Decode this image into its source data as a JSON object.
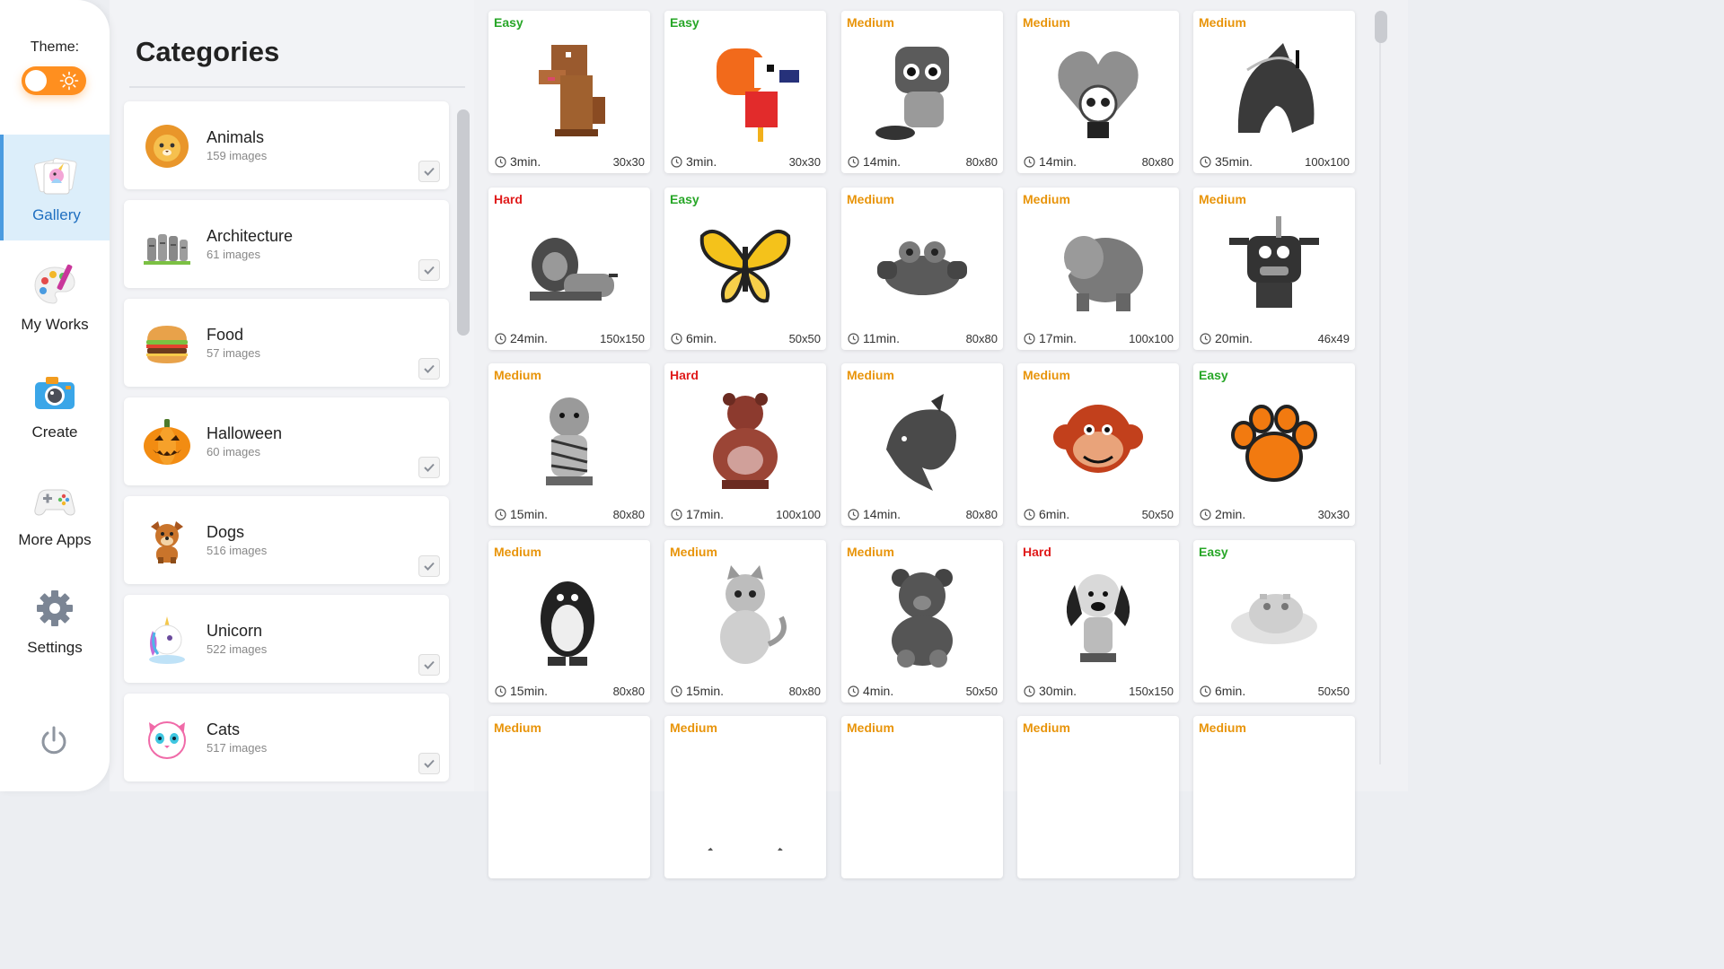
{
  "theme": {
    "label": "Theme:",
    "accent": "#ff8f1f"
  },
  "nav": {
    "items": [
      {
        "label": "Gallery",
        "icon": "gallery-icon",
        "active": true
      },
      {
        "label": "My Works",
        "icon": "palette-icon",
        "active": false
      },
      {
        "label": "Create",
        "icon": "camera-icon",
        "active": false
      },
      {
        "label": "More Apps",
        "icon": "gamepad-icon",
        "active": false
      },
      {
        "label": "Settings",
        "icon": "gear-icon",
        "active": false
      }
    ],
    "power_icon": "power-icon"
  },
  "categories": {
    "title": "Categories",
    "items": [
      {
        "name": "Animals",
        "count": "159 images",
        "icon": "lion-icon",
        "checked": true
      },
      {
        "name": "Architecture",
        "count": "61 images",
        "icon": "moai-icon",
        "checked": true
      },
      {
        "name": "Food",
        "count": "57 images",
        "icon": "burger-icon",
        "checked": true
      },
      {
        "name": "Halloween",
        "count": "60 images",
        "icon": "pumpkin-icon",
        "checked": true
      },
      {
        "name": "Dogs",
        "count": "516 images",
        "icon": "dog-icon",
        "checked": true
      },
      {
        "name": "Unicorn",
        "count": "522 images",
        "icon": "unicorn-icon",
        "checked": true
      },
      {
        "name": "Cats",
        "count": "517 images",
        "icon": "cat-icon",
        "checked": true
      }
    ]
  },
  "difficulty_colors": {
    "Easy": "#27a627",
    "Medium": "#e8940a",
    "Hard": "#e01b1b"
  },
  "gallery": {
    "tiles": [
      {
        "difficulty": "Easy",
        "time": "3min.",
        "size": "30x30",
        "art": "dog-art"
      },
      {
        "difficulty": "Easy",
        "time": "3min.",
        "size": "30x30",
        "art": "toucan-art"
      },
      {
        "difficulty": "Medium",
        "time": "14min.",
        "size": "80x80",
        "art": "kitten-art"
      },
      {
        "difficulty": "Medium",
        "time": "14min.",
        "size": "80x80",
        "art": "panda-heart-art"
      },
      {
        "difficulty": "Medium",
        "time": "35min.",
        "size": "100x100",
        "art": "horse-art"
      },
      {
        "difficulty": "Hard",
        "time": "24min.",
        "size": "150x150",
        "art": "lion-art"
      },
      {
        "difficulty": "Easy",
        "time": "6min.",
        "size": "50x50",
        "art": "butterfly-art"
      },
      {
        "difficulty": "Medium",
        "time": "11min.",
        "size": "80x80",
        "art": "crab-art"
      },
      {
        "difficulty": "Medium",
        "time": "17min.",
        "size": "100x100",
        "art": "mammoth-art"
      },
      {
        "difficulty": "Medium",
        "time": "20min.",
        "size": "46x49",
        "art": "monster-art"
      },
      {
        "difficulty": "Medium",
        "time": "15min.",
        "size": "80x80",
        "art": "tiger-art"
      },
      {
        "difficulty": "Hard",
        "time": "17min.",
        "size": "100x100",
        "art": "bear-art"
      },
      {
        "difficulty": "Medium",
        "time": "14min.",
        "size": "80x80",
        "art": "dolphin-art"
      },
      {
        "difficulty": "Medium",
        "time": "6min.",
        "size": "50x50",
        "art": "monkey-art"
      },
      {
        "difficulty": "Easy",
        "time": "2min.",
        "size": "30x30",
        "art": "paw-art"
      },
      {
        "difficulty": "Medium",
        "time": "15min.",
        "size": "80x80",
        "art": "penguin-art"
      },
      {
        "difficulty": "Medium",
        "time": "15min.",
        "size": "80x80",
        "art": "cat-art"
      },
      {
        "difficulty": "Medium",
        "time": "4min.",
        "size": "50x50",
        "art": "teddy-art"
      },
      {
        "difficulty": "Hard",
        "time": "30min.",
        "size": "150x150",
        "art": "puppy-art"
      },
      {
        "difficulty": "Easy",
        "time": "6min.",
        "size": "50x50",
        "art": "hippo-art"
      },
      {
        "difficulty": "Medium",
        "time": "",
        "size": "",
        "art": "platypus-art"
      },
      {
        "difficulty": "Medium",
        "time": "",
        "size": "",
        "art": "cow-art"
      },
      {
        "difficulty": "Medium",
        "time": "",
        "size": "",
        "art": "owl-art"
      },
      {
        "difficulty": "Medium",
        "time": "",
        "size": "",
        "art": "elephant-art"
      },
      {
        "difficulty": "Medium",
        "time": "",
        "size": "",
        "art": "kitty-art"
      }
    ]
  }
}
